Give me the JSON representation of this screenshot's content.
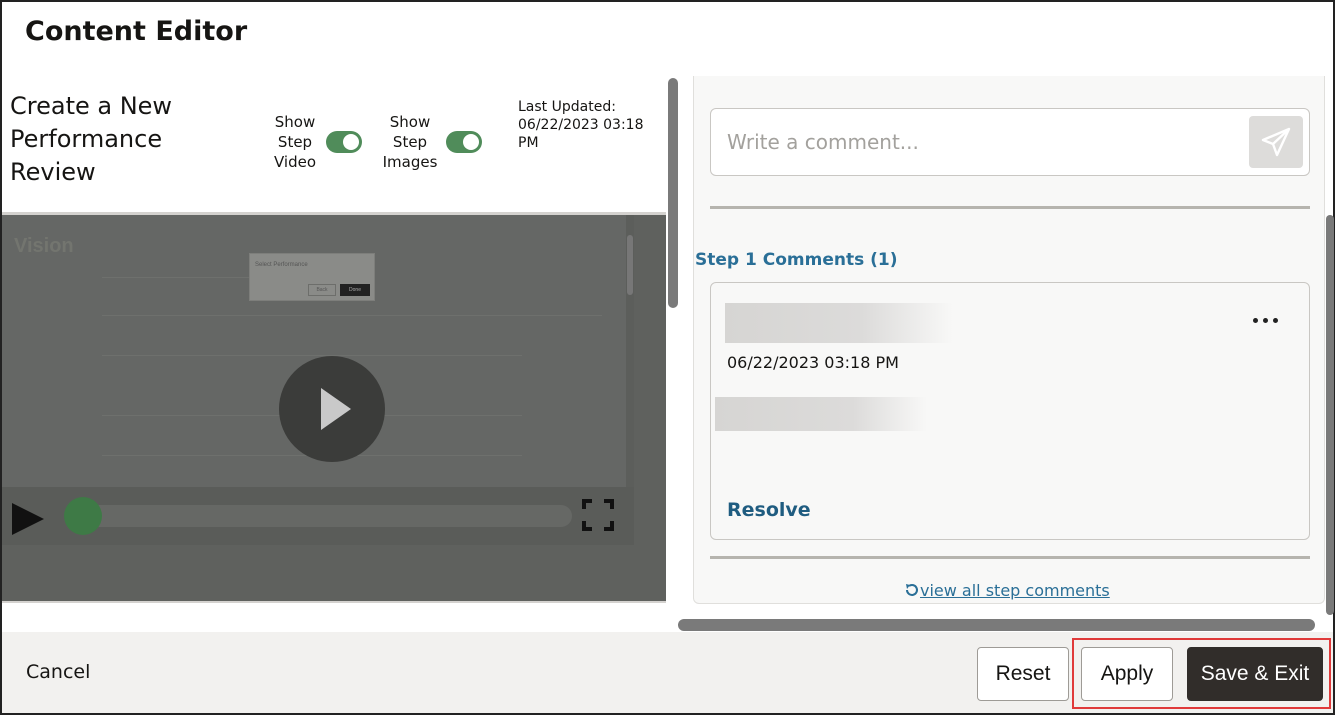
{
  "app": {
    "title": "Content Editor"
  },
  "lesson": {
    "title": "Create a New Performance Review",
    "toggles": [
      {
        "label": "Show Step Video",
        "on": true
      },
      {
        "label": "Show Step Images",
        "on": true
      }
    ],
    "last_updated": "Last Updated: 06/22/2023 03:18 PM"
  },
  "video": {
    "embedded_dialog_title": "Select Performance",
    "embedded_back": "Back",
    "embedded_done": "Done",
    "progress": 0.0
  },
  "comments": {
    "input_placeholder": "Write a comment...",
    "section_title": "Step 1 Comments (1)",
    "items": [
      {
        "date": "06/22/2023 03:18 PM",
        "resolve_label": "Resolve"
      }
    ],
    "view_all_label": "view all step comments"
  },
  "footer": {
    "cancel_label": "Cancel",
    "reset_label": "Reset",
    "apply_label": "Apply",
    "save_exit_label": "Save & Exit"
  },
  "colors": {
    "toggle_on": "#508c5a",
    "link": "#2a6f97",
    "primary_button": "#312d2a",
    "highlight": "#e03a3a"
  }
}
